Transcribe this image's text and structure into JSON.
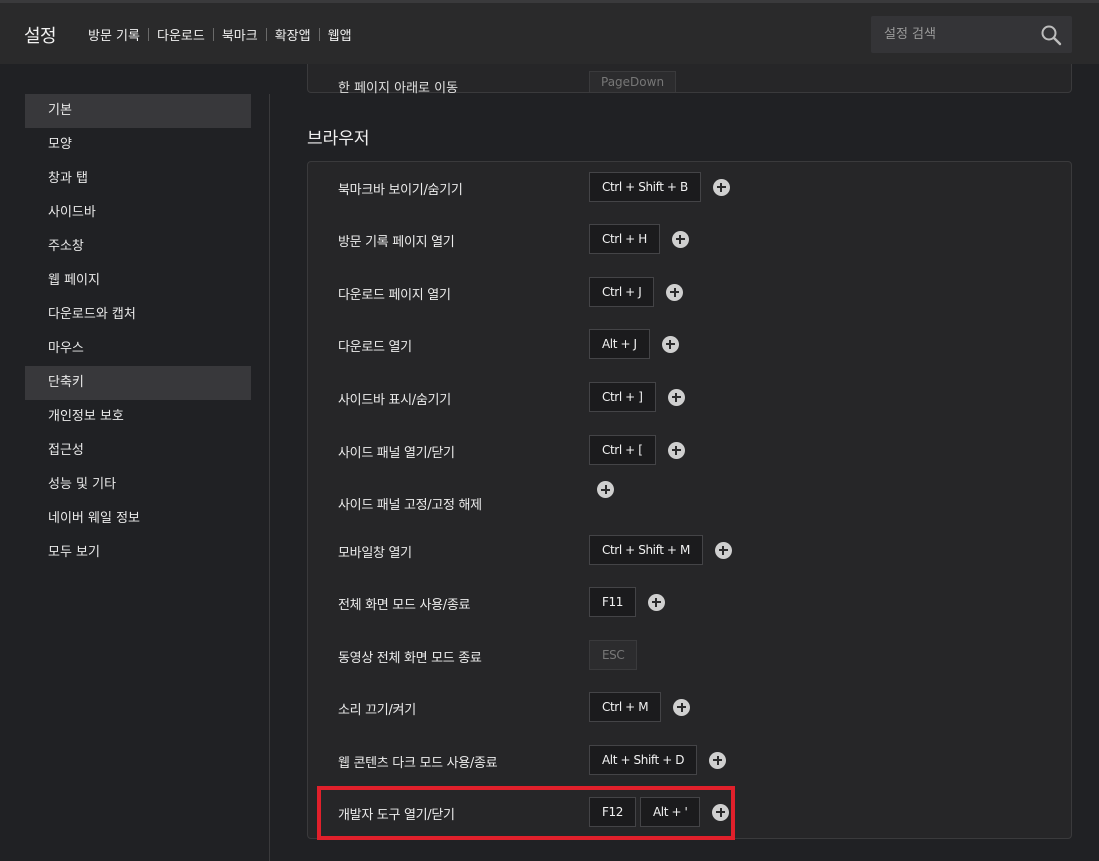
{
  "header": {
    "title": "설정",
    "nav": [
      "방문 기록",
      "다운로드",
      "북마크",
      "확장앱",
      "웹앱"
    ],
    "search_placeholder": "설정 검색"
  },
  "sidebar": {
    "items": [
      {
        "label": "기본",
        "active": true
      },
      {
        "label": "모양",
        "active": false
      },
      {
        "label": "창과 탭",
        "active": false
      },
      {
        "label": "사이드바",
        "active": false
      },
      {
        "label": "주소창",
        "active": false
      },
      {
        "label": "웹 페이지",
        "active": false
      },
      {
        "label": "다운로드와 캡처",
        "active": false
      },
      {
        "label": "마우스",
        "active": false
      },
      {
        "label": "단축키",
        "active": true
      },
      {
        "label": "개인정보 보호",
        "active": false
      },
      {
        "label": "접근성",
        "active": false
      },
      {
        "label": "성능 및 기타",
        "active": false
      },
      {
        "label": "네이버 웨일 정보",
        "active": false
      },
      {
        "label": "모두 보기",
        "active": false
      }
    ]
  },
  "top_row": {
    "label": "한 페이지 아래로 이동",
    "key": "PageDown"
  },
  "section": {
    "title": "브라우저",
    "rows": [
      {
        "label": "북마크바 보이기/숨기기",
        "keys": [
          "Ctrl + Shift + B"
        ]
      },
      {
        "label": "방문 기록 페이지 열기",
        "keys": [
          "Ctrl + H"
        ]
      },
      {
        "label": "다운로드 페이지 열기",
        "keys": [
          "Ctrl + J"
        ]
      },
      {
        "label": "다운로드 열기",
        "keys": [
          "Alt + J"
        ]
      },
      {
        "label": "사이드바 표시/숨기기",
        "keys": [
          "Ctrl + ]"
        ]
      },
      {
        "label": "사이드 패널 열기/닫기",
        "keys": [
          "Ctrl + ["
        ]
      },
      {
        "label": "사이드 패널 고정/고정 해제",
        "keys": []
      },
      {
        "label": "모바일창 열기",
        "keys": [
          "Ctrl + Shift + M"
        ]
      },
      {
        "label": "전체 화면 모드 사용/종료",
        "keys": [
          "F11"
        ]
      },
      {
        "label": "동영상 전체 화면 모드 종료",
        "keys": [
          "ESC"
        ],
        "fixed": true
      },
      {
        "label": "소리 끄기/켜기",
        "keys": [
          "Ctrl + M"
        ]
      },
      {
        "label": "웹 콘텐츠 다크 모드 사용/종료",
        "keys": [
          "Alt + Shift + D"
        ]
      },
      {
        "label": "개발자 도구 열기/닫기",
        "keys": [
          "F12",
          "Alt + '"
        ]
      }
    ]
  },
  "colors": {
    "highlight": "#e0202b",
    "background": "#202124"
  }
}
